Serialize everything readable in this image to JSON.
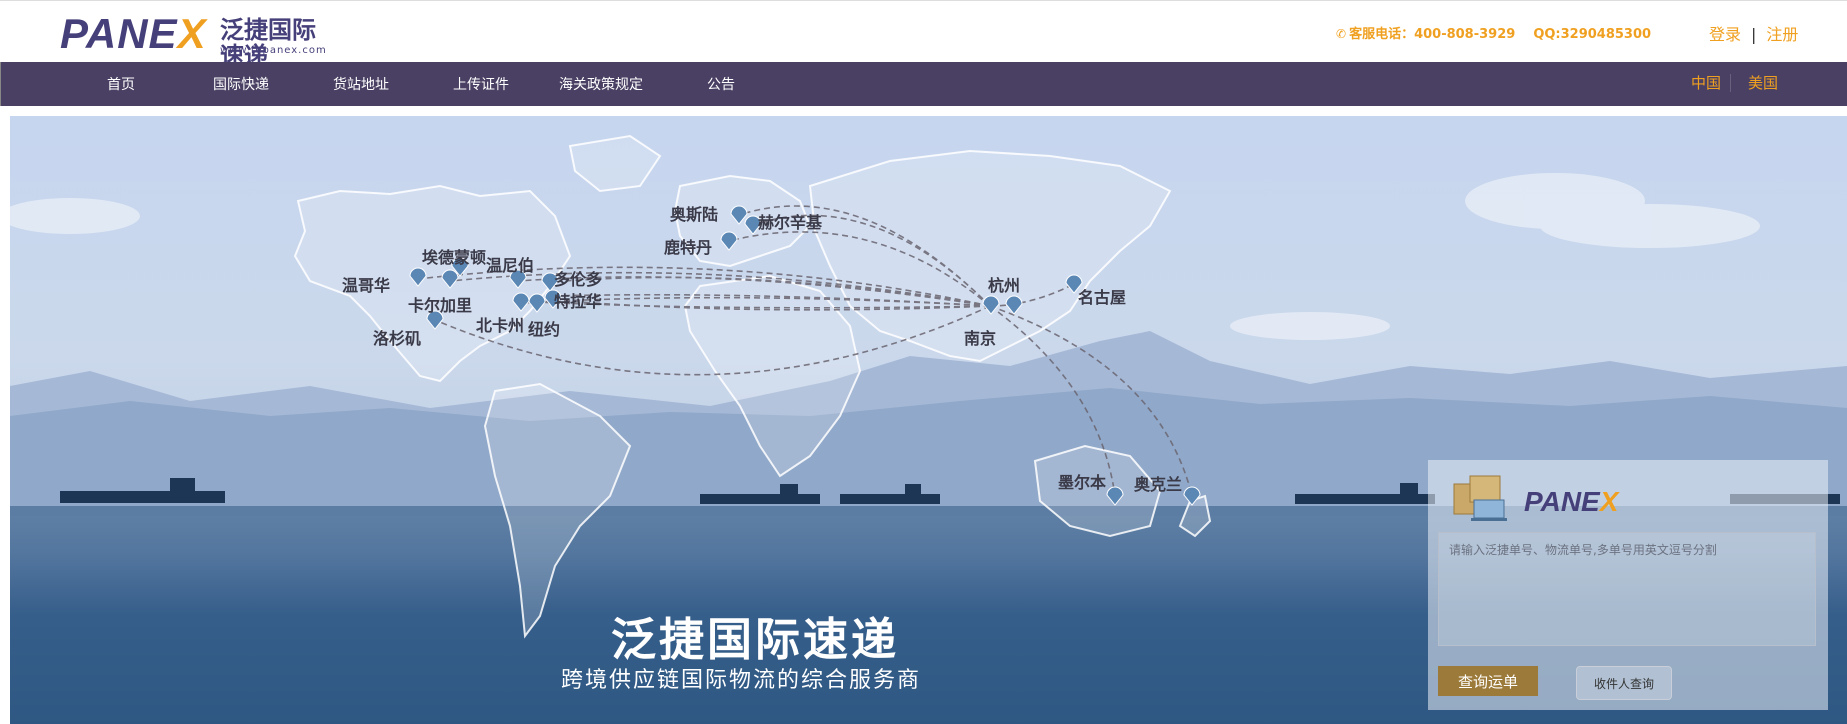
{
  "header": {
    "logo_text": "PANEX",
    "logo_cn": "泛捷国际速递",
    "logo_url": "www.fepanex.com",
    "phone_label": "客服电话：400-808-3929",
    "qq_label": "QQ:3290485300",
    "login": "登录",
    "divider": "|",
    "register": "注册",
    "phone_icon": "phone-icon"
  },
  "nav": {
    "items": [
      "首页",
      "国际快递",
      "货站地址",
      "上传证件",
      "海关政策规定",
      "公告"
    ],
    "regions": [
      "中国",
      "美国"
    ]
  },
  "banner": {
    "title": "泛捷国际速递",
    "subtitle": "跨境供应链国际物流的综合服务商",
    "cities": [
      "温哥华",
      "埃德蒙顿",
      "温尼伯",
      "多伦多",
      "卡尔加里",
      "特拉华",
      "北卡州",
      "纽约",
      "洛杉矶",
      "奥斯陆",
      "赫尔辛基",
      "鹿特丹",
      "杭州",
      "南京",
      "名古屋",
      "墨尔本",
      "奥克兰"
    ]
  },
  "tracking": {
    "logo_text": "PANEX",
    "placeholder": "请输入泛捷单号、物流单号,多单号用英文逗号分割",
    "query_button": "查询运单",
    "receiver_button": "收件人查询"
  },
  "colors": {
    "accent": "#f0a020",
    "nav_bg": "#4a4063",
    "brand": "#46407a",
    "query_button": "#9c7a3a"
  }
}
